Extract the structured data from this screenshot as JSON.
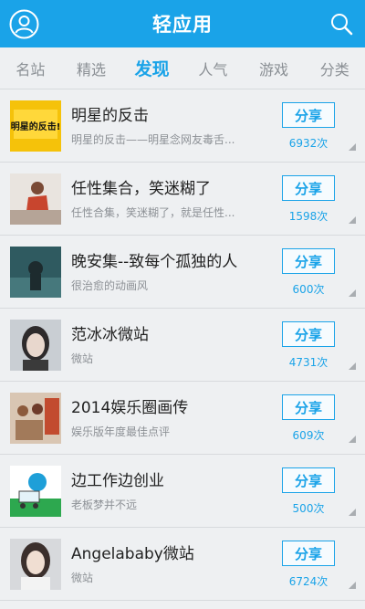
{
  "header": {
    "title": "轻应用",
    "user_icon": "user-avatar-icon",
    "search_icon": "search-icon",
    "bg_color": "#1aa3e8"
  },
  "tabs": [
    {
      "label": "名站",
      "active": false
    },
    {
      "label": "精选",
      "active": false
    },
    {
      "label": "发现",
      "active": true
    },
    {
      "label": "人气",
      "active": false
    },
    {
      "label": "游戏",
      "active": false
    },
    {
      "label": "分类",
      "active": false
    }
  ],
  "share_label": "分享",
  "items": [
    {
      "name": "明星的反击",
      "desc": "明星的反击——明星念网友毒舌...",
      "count": "6932次",
      "thumb_text": "明星的反击!"
    },
    {
      "name": "任性集合，笑迷糊了",
      "desc": "任性合集，笑迷糊了，就是任性...",
      "count": "1598次"
    },
    {
      "name": "晚安集--致每个孤独的人",
      "desc": "很治愈的动画风",
      "count": "600次"
    },
    {
      "name": "范冰冰微站",
      "desc": "微站",
      "count": "4731次"
    },
    {
      "name": "2014娱乐圈画传",
      "desc": "娱乐版年度最佳点评",
      "count": "609次"
    },
    {
      "name": "边工作边创业",
      "desc": "老板梦并不远",
      "count": "500次"
    },
    {
      "name": "Angelababy微站",
      "desc": "微站",
      "count": "6724次"
    }
  ]
}
